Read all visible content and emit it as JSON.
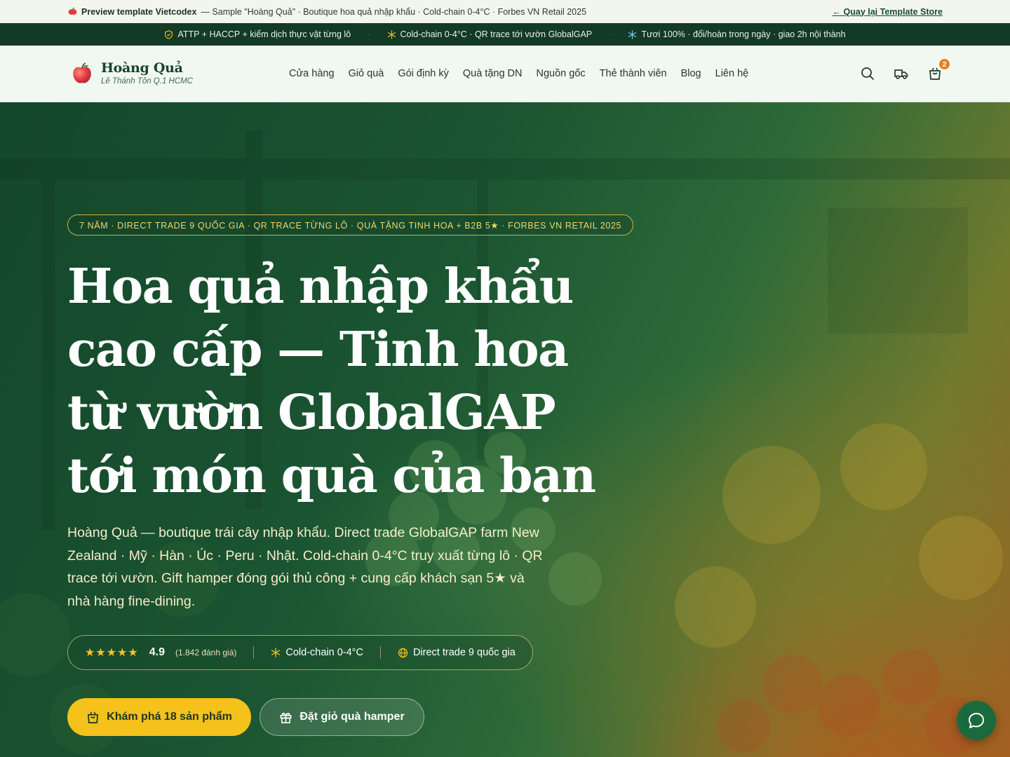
{
  "preview_bar": {
    "label": "Preview template Vietcodex",
    "description": "— Sample \"Hoàng Quả\" · Boutique hoa quả nhập khẩu · Cold-chain 0-4°C · Forbes VN Retail 2025",
    "back_link": "← Quay lại Template Store"
  },
  "trust_strip": {
    "items": [
      {
        "icon": "shield-icon",
        "text": "ATTP + HACCP + kiểm dịch thực vật từng lô"
      },
      {
        "icon": "snowflake-icon",
        "text": "Cold-chain 0-4°C · QR trace tới vườn GlobalGAP"
      },
      {
        "icon": "snowflake-icon",
        "text": "Tươi 100% · đổi/hoàn trong ngày · giao 2h nội thành"
      }
    ],
    "separator": "·"
  },
  "header": {
    "brand_name": "Hoàng Quả",
    "brand_sub": "Lê Thánh Tôn Q.1 HCMC",
    "nav": [
      "Cửa hàng",
      "Giỏ quà",
      "Gói định kỳ",
      "Quà tặng DN",
      "Nguồn gốc",
      "Thẻ thành viên",
      "Blog",
      "Liên hệ"
    ],
    "cart_count": "2"
  },
  "hero": {
    "badge": "7 NĂM · DIRECT TRADE 9 QUỐC GIA · QR TRACE TỪNG LÔ · QUÀ TẶNG TINH HOA + B2B 5★ · FORBES VN RETAIL 2025",
    "headline": "Hoa quả nhập khẩu cao cấp — Tinh hoa từ vườn GlobalGAP tới món quà của bạn",
    "lead": "Hoàng Quả — boutique trái cây nhập khẩu. Direct trade GlobalGAP farm New Zealand · Mỹ · Hàn · Úc · Peru · Nhật. Cold-chain 0-4°C truy xuất từng lô · QR trace tới vườn. Gift hamper đóng gói thủ công + cung cấp khách sạn 5★ và nhà hàng fine-dining.",
    "stats": {
      "stars": "★★★★★",
      "rating": "4.9",
      "count": "(1.842 đánh giá)",
      "coldchain": "Cold-chain 0-4°C",
      "direct_trade": "Direct trade 9 quốc gia"
    },
    "cta_primary": "Khám phá 18 sản phẩm",
    "cta_secondary": "Đặt giỏ quà hamper"
  },
  "colors": {
    "accent": "#f4c21b",
    "brand_green": "#123a25",
    "badge_orange": "#e8801e"
  }
}
